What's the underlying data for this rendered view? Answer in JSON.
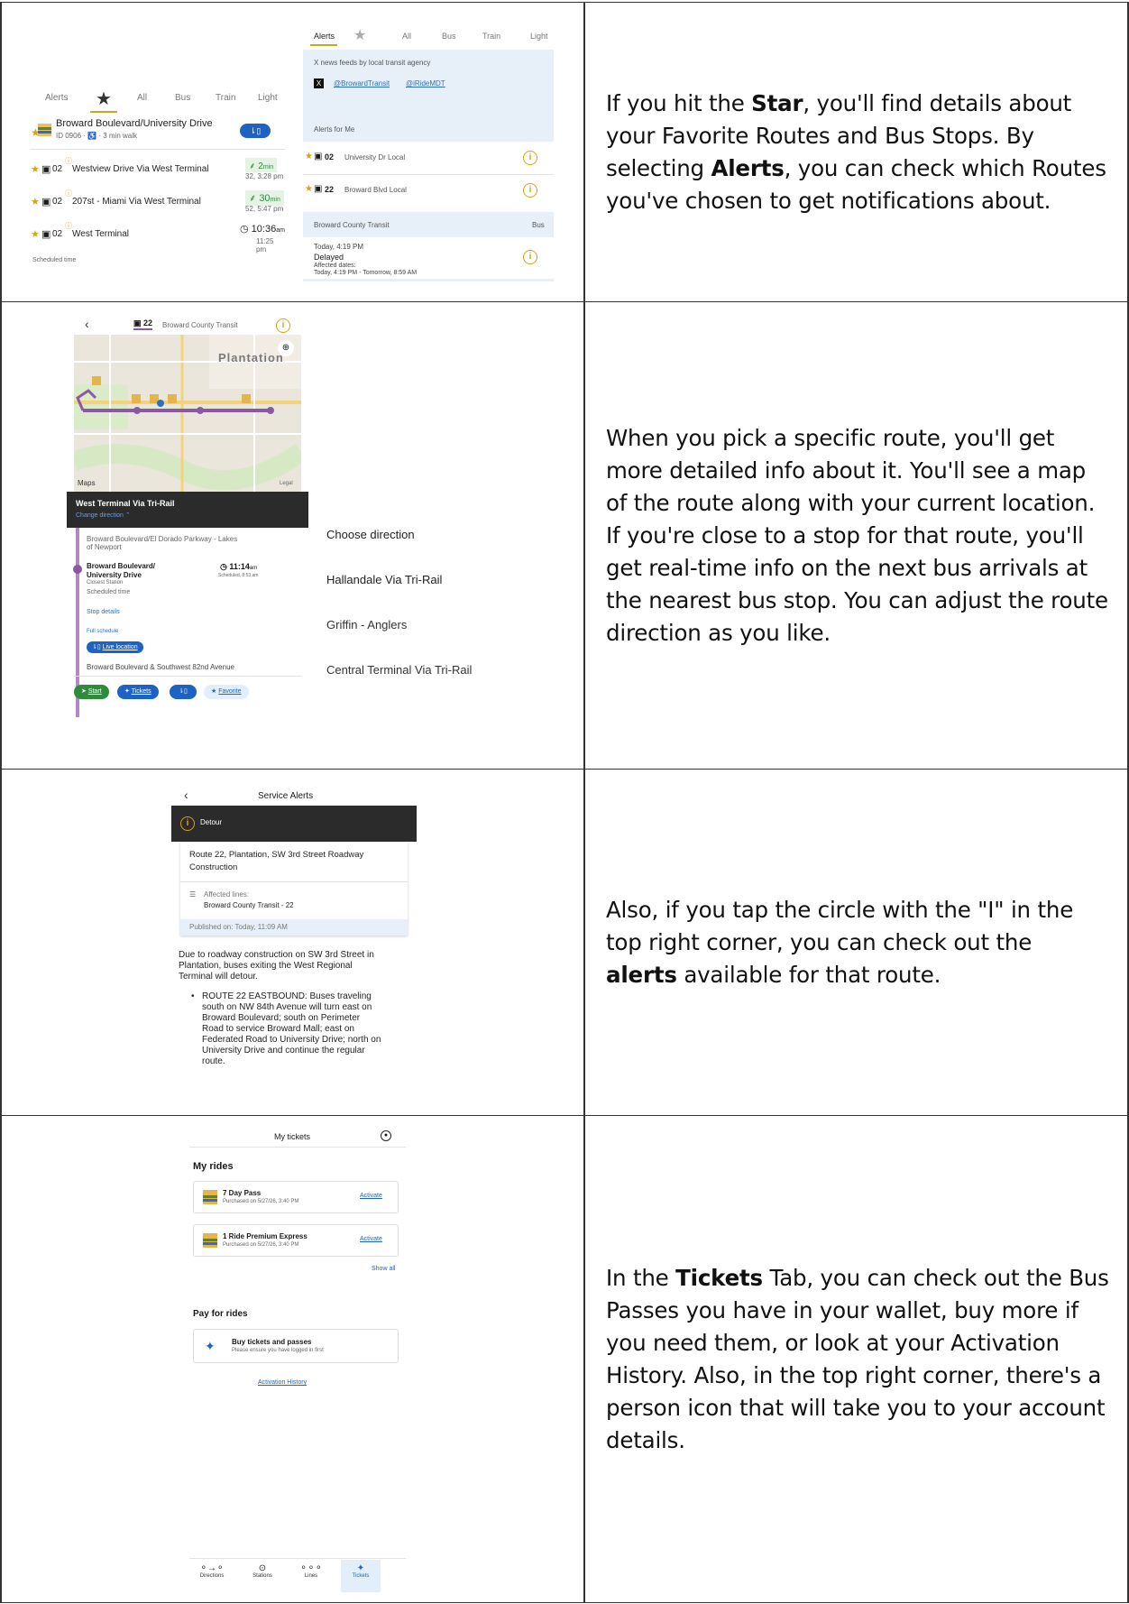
{
  "row1": {
    "favorites": {
      "tabs": [
        "Alerts",
        "All",
        "Bus",
        "Train",
        "Light"
      ],
      "stop_name": "Broward Boulevard/University Drive",
      "stop_meta": "ID 0906 · ♿ · 3 min walk",
      "routes": [
        {
          "route": "02",
          "dest": "Westview Drive Via West Terminal",
          "time": "2",
          "unit": "min",
          "sub": "32, 3:28 pm"
        },
        {
          "route": "02",
          "dest": "207st - Miami Via West Terminal",
          "time": "30",
          "unit": "min",
          "sub": "52, 5:47 pm"
        },
        {
          "route": "02",
          "dest": "West Terminal",
          "time": "10:36",
          "unit": "am",
          "sub": "11:25 pm"
        }
      ],
      "scheduled": "Scheduled time"
    },
    "alerts": {
      "tabs": [
        "Alerts",
        "All",
        "Bus",
        "Train",
        "Light"
      ],
      "news_label": "X news feeds by local transit agency",
      "handles": [
        "@BrowardTransit",
        "@iRideMDT"
      ],
      "alerts_for_me": "Alerts for Me",
      "items": [
        {
          "route": "02",
          "name": "University Dr Local"
        },
        {
          "route": "22",
          "name": "Broward Blvd Local"
        }
      ],
      "agency": "Broward County Transit",
      "mode": "Bus",
      "alert_time": "Today, 4:19 PM",
      "alert_status": "Delayed",
      "affected_label": "Affected dates:",
      "affected_range": "Today, 4:19 PM - Tomorrow, 8:59 AM"
    },
    "desc_parts": [
      "If you hit the ",
      "Star",
      ", you'll find details about your Favorite Routes and Bus Stops. By selecting ",
      "Alerts",
      ", you can check which Routes you've chosen to get notifications about."
    ]
  },
  "row2": {
    "route_no": "22",
    "agency": "Broward County Transit",
    "map_label": "Plantation",
    "maps_brand": "Maps",
    "legal": "Legal",
    "direction_title": "West Terminal Via Tri-Rail",
    "change_direction": "Change direction",
    "stop1": "Broward Boulevard/El Dorado Parkway - Lakes of Newport",
    "stop2_a": "Broward Boulevard/",
    "stop2_b": "University Drive",
    "closest": "Closest Station",
    "arrival": "11:14",
    "arrival_unit": "am",
    "arrival_sub": "Scheduled, 8:53 am",
    "scheduled_time": "Scheduled time",
    "stop_details": "Stop details",
    "full_schedule": "Full schedule",
    "live_location": "Live location",
    "stop3": "Broward Boulevard & Southwest 82nd Avenue",
    "buttons": [
      "Start",
      "Tickets",
      "Favorite"
    ],
    "choose_title": "Choose direction",
    "choices": [
      "Hallandale Via Tri-Rail",
      "Griffin - Anglers",
      "Central Terminal Via Tri-Rail"
    ],
    "desc": "When you pick a specific route, you'll get more detailed info about it. You'll see a map of the route along with your current location. If you're close to a stop for that route, you'll get real-time info on the next bus arrivals at the nearest bus stop. You can adjust the route direction as you like."
  },
  "row3": {
    "header": "Service Alerts",
    "banner": "Detour",
    "title": "Route 22, Plantation, SW 3rd Street Roadway Construction",
    "affected_lines": "Affected lines:",
    "line_name": "Broward County Transit - 22",
    "published": "Published on: Today, 11:09 AM",
    "body": "Due to roadway construction on SW 3rd Street in Plantation, buses exiting the West Regional Terminal will detour.",
    "bullet": "ROUTE 22 EASTBOUND: Buses traveling south on NW 84th Avenue will turn east on Broward Boulevard; south on Perimeter Road to service Broward Mall; east on Federated Road to University Drive; north on University Drive and continue the regular route.",
    "desc_parts": [
      "Also, if you tap the circle with the \"I\" in the top right corner, you can check out the ",
      "alerts",
      " available for that route."
    ]
  },
  "row4": {
    "header": "My tickets",
    "my_rides": "My rides",
    "passes": [
      {
        "name": "7 Day Pass",
        "purchased": "Purchased on 5/27/26, 3:40 PM",
        "action": "Activate"
      },
      {
        "name": "1 Ride Premium Express",
        "purchased": "Purchased on 5/27/26, 3:40 PM",
        "action": "Activate"
      }
    ],
    "show_all": "Show all",
    "pay_for_rides": "Pay for rides",
    "buy_title": "Buy tickets and passes",
    "buy_sub": "Please ensure you have logged in first",
    "activation_history": "Activation History",
    "nav": [
      "Directions",
      "Stations",
      "Lines",
      "Tickets"
    ],
    "desc_parts": [
      "In the ",
      "Tickets",
      " Tab, you can check out the Bus Passes you have in your wallet, buy more if you need them, or look at your Activation History. Also, in the top right corner, there's a person icon that will take you to your account details."
    ]
  },
  "colors": {
    "accent_blue": "#1e63c4",
    "alert_orange": "#d6a21a",
    "route_green": "#2f8a3d",
    "dark_banner": "#2b2b2b",
    "route_purple": "#8a5aa0"
  }
}
